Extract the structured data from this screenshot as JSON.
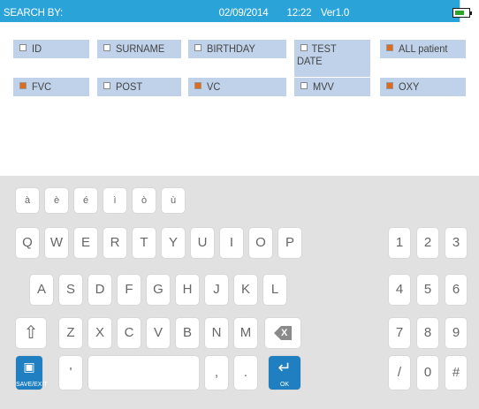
{
  "header": {
    "title": "SEARCH BY:",
    "date": "02/09/2014",
    "time": "12:22",
    "version": "Ver1.0"
  },
  "options": [
    {
      "label": "ID",
      "checked": false
    },
    {
      "label": "SURNAME",
      "checked": false
    },
    {
      "label": "BIRTHDAY",
      "checked": false
    },
    {
      "label": "TEST DATE",
      "checked": false
    },
    {
      "label": "ALL patient",
      "checked": true
    },
    {
      "label": "FVC",
      "checked": true
    },
    {
      "label": "POST",
      "checked": false
    },
    {
      "label": "VC",
      "checked": true
    },
    {
      "label": "MVV",
      "checked": false
    },
    {
      "label": "OXY",
      "checked": true
    }
  ],
  "keyboard": {
    "accents": [
      "à",
      "è",
      "é",
      "ì",
      "ò",
      "ù"
    ],
    "row1": [
      "Q",
      "W",
      "E",
      "R",
      "T",
      "Y",
      "U",
      "I",
      "O",
      "P"
    ],
    "row2": [
      "A",
      "S",
      "D",
      "F",
      "G",
      "H",
      "J",
      "K",
      "L"
    ],
    "row3": [
      "Z",
      "X",
      "C",
      "V",
      "B",
      "N",
      "M"
    ],
    "shift_glyph": "⇧",
    "backspace_glyph": "X",
    "apostrophe": "'",
    "comma": ",",
    "period": ".",
    "save_label": "SAVE/EXIT",
    "ok_label": "OK",
    "enter_glyph": "↵",
    "save_glyph": "▣",
    "numpad": [
      "1",
      "2",
      "3",
      "4",
      "5",
      "6",
      "7",
      "8",
      "9",
      "/",
      "0",
      "#"
    ]
  },
  "colors": {
    "header_bg": "#2aa3d8",
    "checkbox_bg": "#bfd2ea",
    "checked_box": "#e06a1c",
    "keyboard_bg": "#e1e1e1",
    "action_key": "#1f7fc0"
  }
}
